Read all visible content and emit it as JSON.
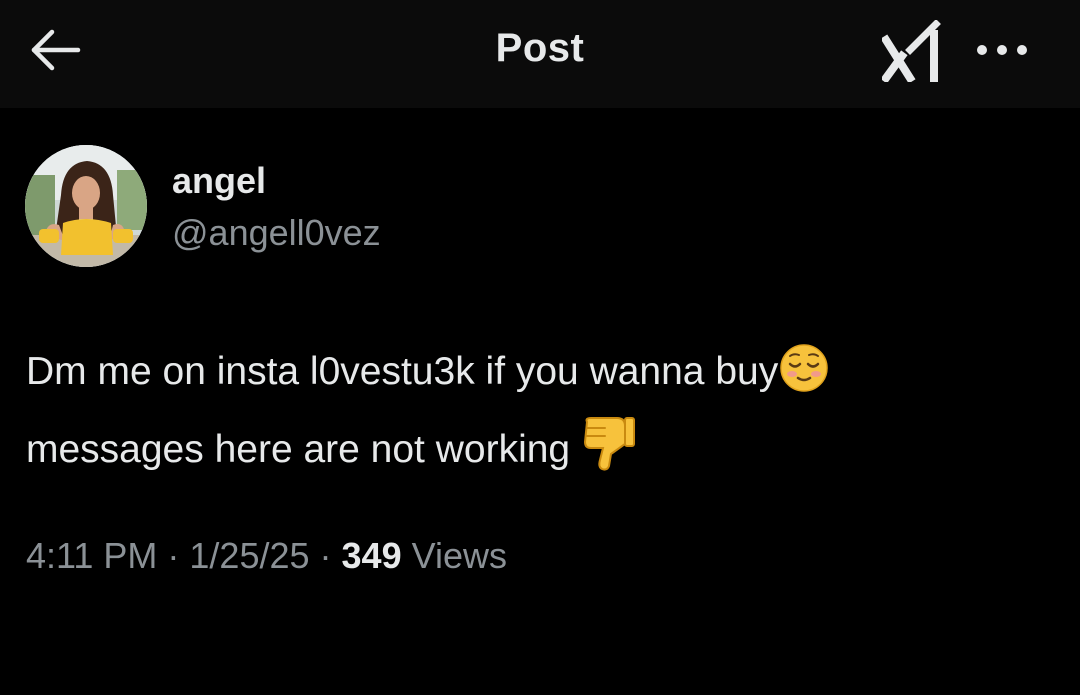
{
  "header": {
    "title": "Post",
    "back_icon": "arrow-left-icon",
    "grok_icon": "grok-icon",
    "more_icon": "more-horizontal-icon"
  },
  "post": {
    "author": {
      "display_name": "angel",
      "handle": "@angell0vez",
      "avatar_icon": "avatar"
    },
    "text_line1": "Dm me on insta l0vestu3k if you wanna buy",
    "emoji1": "smiling-face-icon",
    "text_line2": "messages here are not working ",
    "emoji2": "thumbs-down-icon",
    "time": "4:11 PM",
    "separator": " · ",
    "date": "1/25/25",
    "views_count": "349",
    "views_label": " Views"
  },
  "colors": {
    "background": "#000000",
    "header_background": "#0b0b0b",
    "primary_text": "#e7e9ea",
    "secondary_text": "#8b9196",
    "emoji_yellow": "#f7c23c"
  }
}
